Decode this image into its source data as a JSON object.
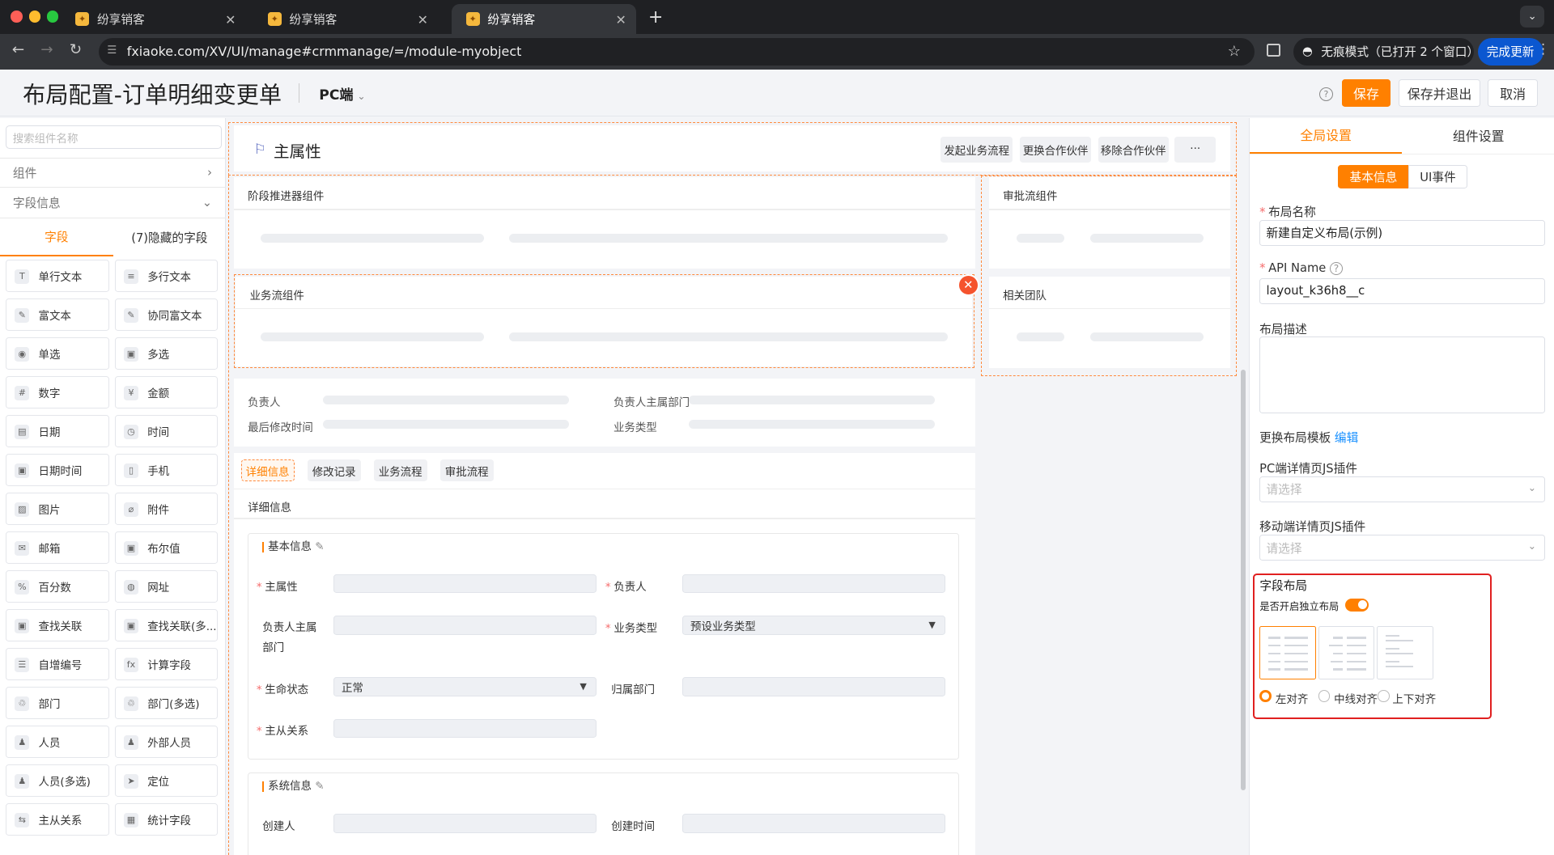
{
  "browser": {
    "tabs": [
      {
        "title": "纷享销客"
      },
      {
        "title": "纷享销客"
      },
      {
        "title": "纷享销客"
      }
    ],
    "url": "fxiaoke.com/XV/UI/manage#crmmanage/=/module-myobject",
    "incognito": "无痕模式（已打开 2 个窗口）",
    "update": "完成更新"
  },
  "header": {
    "title": "布局配置-订单明细变更单",
    "platform": "PC端",
    "buttons": {
      "save": "保存",
      "save_exit": "保存并退出",
      "cancel": "取消"
    }
  },
  "left": {
    "search_placeholder": "搜索组件名称",
    "components": "组件",
    "field_info": "字段信息",
    "tabs": [
      "字段",
      "(7)隐藏的字段"
    ],
    "fields": [
      [
        "单行文本",
        "多行文本"
      ],
      [
        "富文本",
        "协同富文本"
      ],
      [
        "单选",
        "多选"
      ],
      [
        "数字",
        "金额"
      ],
      [
        "日期",
        "时间"
      ],
      [
        "日期时间",
        "手机"
      ],
      [
        "图片",
        "附件"
      ],
      [
        "邮箱",
        "布尔值"
      ],
      [
        "百分数",
        "网址"
      ],
      [
        "查找关联",
        "查找关联(多..."
      ],
      [
        "自增编号",
        "计算字段"
      ],
      [
        "部门",
        "部门(多选)"
      ],
      [
        "人员",
        "外部人员"
      ],
      [
        "人员(多选)",
        "定位"
      ],
      [
        "主从关系",
        "统计字段"
      ]
    ],
    "icons": [
      [
        "T",
        "≡"
      ],
      [
        "✎",
        "✎"
      ],
      [
        "◉",
        "▣"
      ],
      [
        "#",
        "¥"
      ],
      [
        "▤",
        "◷"
      ],
      [
        "▣",
        "▯"
      ],
      [
        "▨",
        "⌀"
      ],
      [
        "✉",
        "▣"
      ],
      [
        "%",
        "◍"
      ],
      [
        "▣",
        "▣"
      ],
      [
        "☰",
        "fx"
      ],
      [
        "♲",
        "♲"
      ],
      [
        "♟",
        "♟"
      ],
      [
        "♟",
        "➤"
      ],
      [
        "⇆",
        "▦"
      ]
    ]
  },
  "canvas": {
    "primary_title": "主属性",
    "actions": [
      "发起业务流程",
      "更换合作伙伴",
      "移除合作伙伴",
      "···"
    ],
    "stage": "阶段推进器组件",
    "approval": "审批流组件",
    "flow": "业务流组件",
    "team": "相关团队",
    "summary": {
      "owner": "负责人",
      "owner_dept": "负责人主属部门",
      "modified": "最后修改时间",
      "biz_type": "业务类型"
    },
    "detail_tabs": [
      "详细信息",
      "修改记录",
      "业务流程",
      "审批流程"
    ],
    "detail_title": "详细信息",
    "basic_group": "基本信息",
    "system_group": "系统信息",
    "form": {
      "main_attr": "主属性",
      "owner": "负责人",
      "owner_dept": "负责人主属部门",
      "biz_type": "业务类型",
      "biz_type_val": "预设业务类型",
      "life": "生命状态",
      "life_val": "正常",
      "belong_dept": "归属部门",
      "master": "主从关系",
      "creator": "创建人",
      "create_time": "创建时间"
    }
  },
  "right": {
    "tabs": [
      "全局设置",
      "组件设置"
    ],
    "seg": [
      "基本信息",
      "UI事件"
    ],
    "layout_name_label": "布局名称",
    "layout_name": "新建自定义布局(示例)",
    "api_label": "API Name",
    "api": "layout_k36h8__c",
    "desc_label": "布局描述",
    "template_label": "更换布局模板",
    "edit": "编辑",
    "pc_js": "PC端详情页JS插件",
    "mobile_js": "移动端详情页JS插件",
    "placeholder": "请选择",
    "field_layout": "字段布局",
    "independent": "是否开启独立布局",
    "independent_on": true,
    "align": [
      "左对齐",
      "中线对齐",
      "上下对齐"
    ],
    "align_selected": "左对齐"
  },
  "colors": {
    "accent": "#ff8000",
    "highlight": "#e02020",
    "link": "#1890ff"
  }
}
